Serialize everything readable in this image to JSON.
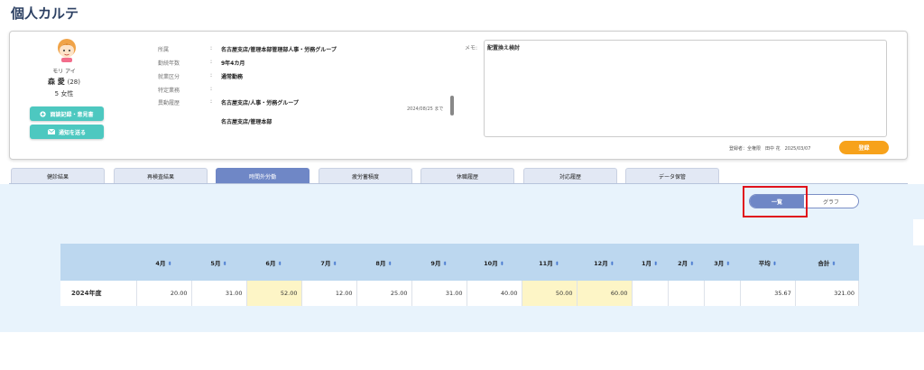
{
  "page": {
    "title": "個人カルテ"
  },
  "employee": {
    "furigana": "モリ アイ",
    "name": "森 愛",
    "age": "(28)",
    "number": "5",
    "gender": "女性",
    "avatar_icon": "female-avatar-icon"
  },
  "buttons": {
    "interview": "面談記録・意見書",
    "notify": "通知を送る",
    "register": "登録"
  },
  "info": {
    "affiliation_label": "所属",
    "affiliation_value": "名古屋支店/管理本部管理部人事・労務グループ",
    "tenure_label": "勤続年数",
    "tenure_value": "9年4カ月",
    "work_type_label": "就業区分",
    "work_type_value": "通常勤務",
    "special_label": "特定業務",
    "special_value": "",
    "transfer_label": "異動履歴",
    "transfer_1": "名古屋支店/人事・労務グループ",
    "transfer_1_date": "2024/08/25 まで",
    "transfer_2": "名古屋支店/管理本部",
    "colon": ":"
  },
  "memo": {
    "label": "メモ:",
    "value": "配置換え検討",
    "registrant": "登録者：全権限　田中 花　2025/03/07"
  },
  "tabs": [
    "健診結果",
    "再検査結果",
    "時間外労働",
    "疲労蓄積度",
    "休職履歴",
    "対応履歴",
    "データ保管"
  ],
  "active_tab": "時間外労働",
  "view_toggle": {
    "list": "一覧",
    "graph": "グラフ"
  },
  "table": {
    "headers": [
      "",
      "4月",
      "5月",
      "6月",
      "7月",
      "8月",
      "9月",
      "10月",
      "11月",
      "12月",
      "1月",
      "2月",
      "3月",
      "平均",
      "合計"
    ],
    "rows": [
      {
        "label": "2024年度",
        "cells": [
          "20.00",
          "31.00",
          "52.00",
          "12.00",
          "25.00",
          "31.00",
          "40.00",
          "50.00",
          "60.00",
          "",
          "",
          "",
          "35.67",
          "321.00"
        ],
        "highlight": [
          false,
          false,
          true,
          false,
          false,
          false,
          false,
          true,
          true,
          false,
          false,
          false,
          false,
          false
        ]
      }
    ],
    "highlight_color": "#fdf5c6",
    "sort_icon": "sort-updown-icon"
  },
  "colors": {
    "accent": "#6f87c6",
    "teal_button": "#4dc8c0",
    "register": "#f7a21b",
    "highlight_border": "#e0121b",
    "content_bg": "#e8f3fc",
    "table_header": "#bcd7ef"
  }
}
